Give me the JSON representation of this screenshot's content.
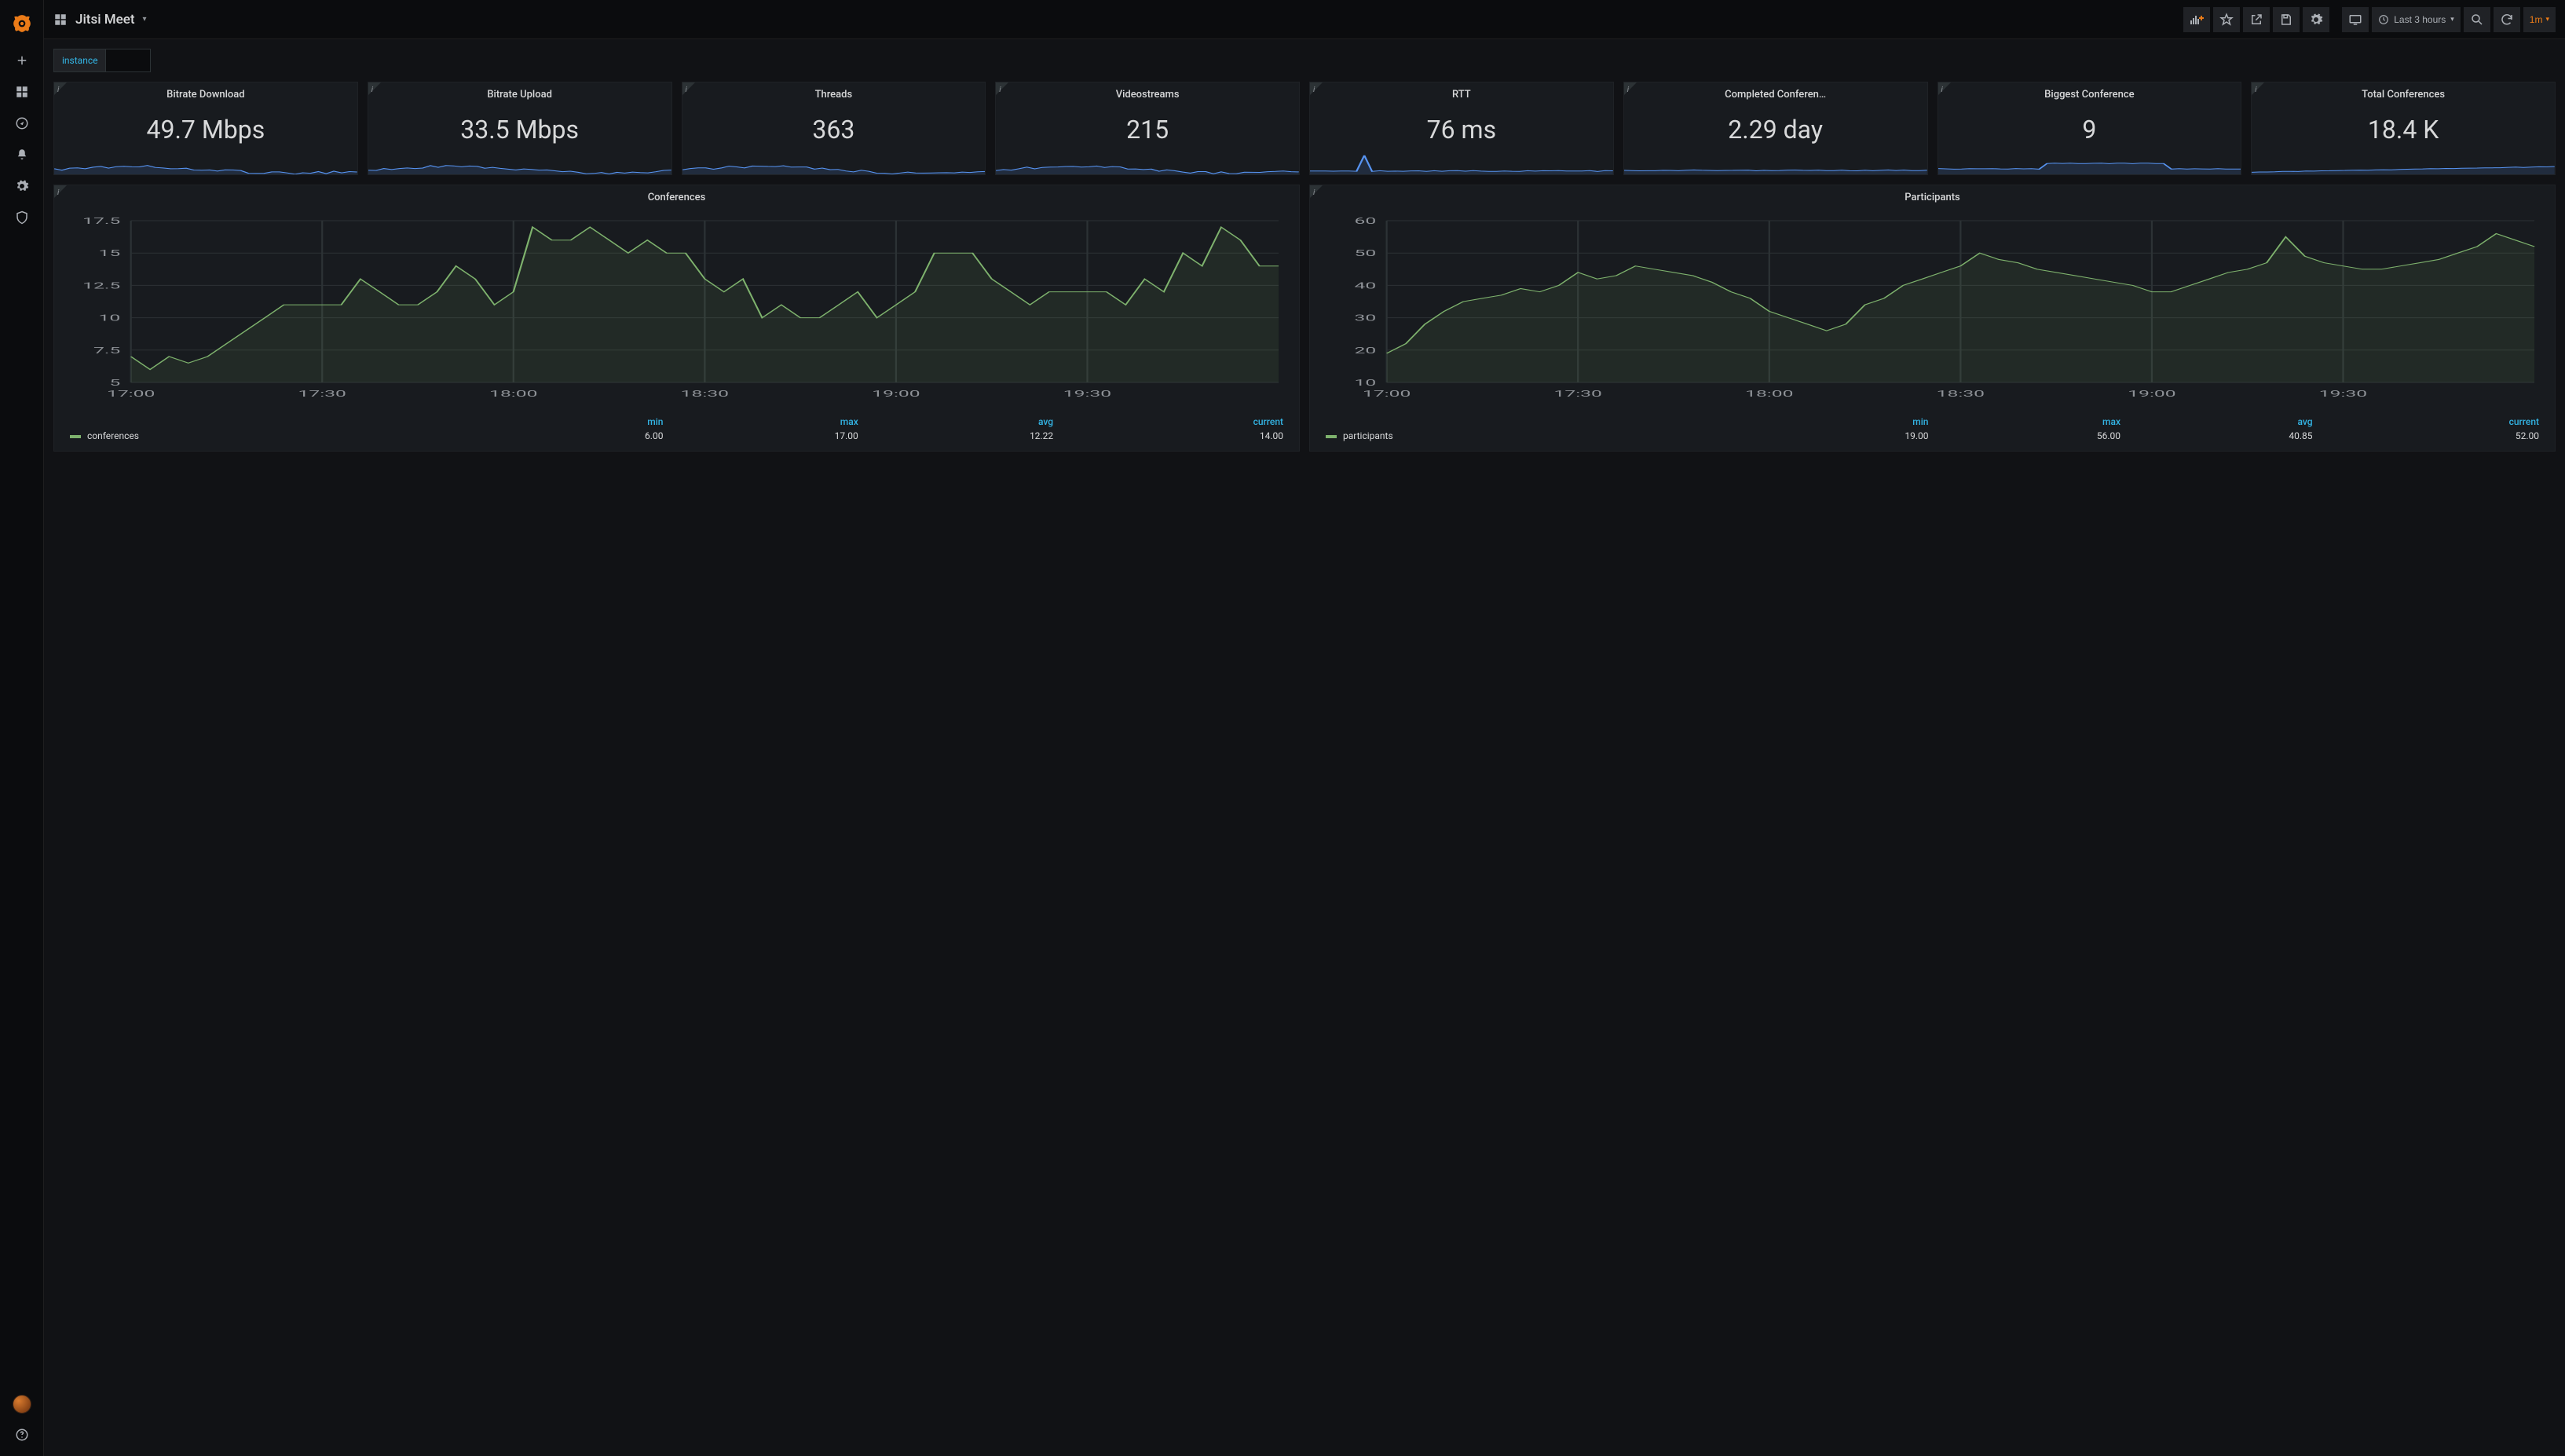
{
  "dashboard_title": "Jitsi Meet",
  "time_range": "Last 3 hours",
  "refresh_interval": "1m",
  "variable": {
    "label": "instance",
    "value": ""
  },
  "stat_panels": [
    {
      "title": "Bitrate Download",
      "value": "49.7 Mbps"
    },
    {
      "title": "Bitrate Upload",
      "value": "33.5 Mbps"
    },
    {
      "title": "Threads",
      "value": "363"
    },
    {
      "title": "Videostreams",
      "value": "215"
    },
    {
      "title": "RTT",
      "value": "76 ms"
    },
    {
      "title": "Completed Conferen…",
      "value": "2.29 day"
    },
    {
      "title": "Biggest Conference",
      "value": "9"
    },
    {
      "title": "Total Conferences",
      "value": "18.4 K"
    }
  ],
  "chart_panels": [
    {
      "title": "Conferences",
      "series_name": "conferences",
      "legend_headers": [
        "min",
        "max",
        "avg",
        "current"
      ],
      "legend_values": [
        "6.00",
        "17.00",
        "12.22",
        "14.00"
      ]
    },
    {
      "title": "Participants",
      "series_name": "participants",
      "legend_headers": [
        "min",
        "max",
        "avg",
        "current"
      ],
      "legend_values": [
        "19.00",
        "56.00",
        "40.85",
        "52.00"
      ]
    }
  ],
  "chart_data": [
    {
      "type": "line",
      "title": "Conferences",
      "xlabel": "",
      "ylabel": "",
      "ylim": [
        5,
        17.5
      ],
      "x_ticks": [
        "17:00",
        "17:30",
        "18:00",
        "18:30",
        "19:00",
        "19:30"
      ],
      "y_ticks": [
        5.0,
        7.5,
        10.0,
        12.5,
        15.0,
        17.5
      ],
      "series": [
        {
          "name": "conferences",
          "x_minutes": [
            0,
            3,
            6,
            9,
            12,
            15,
            18,
            21,
            24,
            27,
            30,
            33,
            36,
            39,
            42,
            45,
            48,
            51,
            54,
            57,
            60,
            63,
            66,
            69,
            72,
            75,
            78,
            81,
            84,
            87,
            90,
            93,
            96,
            99,
            102,
            105,
            108,
            111,
            114,
            117,
            120,
            123,
            126,
            129,
            132,
            135,
            138,
            141,
            144,
            147,
            150,
            153,
            156,
            159,
            162,
            165,
            168,
            171,
            174,
            177,
            180
          ],
          "y": [
            7,
            6,
            7,
            6.5,
            7,
            8,
            9,
            10,
            11,
            11,
            11,
            11,
            13,
            12,
            11,
            11,
            12,
            14,
            13,
            11,
            12,
            17,
            16,
            16,
            17,
            16,
            15,
            16,
            15,
            15,
            13,
            12,
            13,
            10,
            11,
            10,
            10,
            11,
            12,
            10,
            11,
            12,
            15,
            15,
            15,
            13,
            12,
            11,
            12,
            12,
            12,
            12,
            11,
            13,
            12,
            15,
            14,
            17,
            16,
            14,
            14
          ]
        }
      ]
    },
    {
      "type": "line",
      "title": "Participants",
      "xlabel": "",
      "ylabel": "",
      "ylim": [
        10,
        60
      ],
      "x_ticks": [
        "17:00",
        "17:30",
        "18:00",
        "18:30",
        "19:00",
        "19:30"
      ],
      "y_ticks": [
        10,
        20,
        30,
        40,
        50,
        60
      ],
      "series": [
        {
          "name": "participants",
          "x_minutes": [
            0,
            3,
            6,
            9,
            12,
            15,
            18,
            21,
            24,
            27,
            30,
            33,
            36,
            39,
            42,
            45,
            48,
            51,
            54,
            57,
            60,
            63,
            66,
            69,
            72,
            75,
            78,
            81,
            84,
            87,
            90,
            93,
            96,
            99,
            102,
            105,
            108,
            111,
            114,
            117,
            120,
            123,
            126,
            129,
            132,
            135,
            138,
            141,
            144,
            147,
            150,
            153,
            156,
            159,
            162,
            165,
            168,
            171,
            174,
            177,
            180
          ],
          "y": [
            19,
            22,
            28,
            32,
            35,
            36,
            37,
            39,
            38,
            40,
            44,
            42,
            43,
            46,
            45,
            44,
            43,
            41,
            38,
            36,
            32,
            30,
            28,
            26,
            28,
            34,
            36,
            40,
            42,
            44,
            46,
            50,
            48,
            47,
            45,
            44,
            43,
            42,
            41,
            40,
            38,
            38,
            40,
            42,
            44,
            45,
            47,
            55,
            49,
            47,
            46,
            45,
            45,
            46,
            47,
            48,
            50,
            52,
            56,
            54,
            52
          ]
        }
      ]
    }
  ],
  "sidebar_icons": [
    "plus-icon",
    "dashboard-grid-icon",
    "compass-icon",
    "bell-icon",
    "gear-icon",
    "shield-icon"
  ],
  "colors": {
    "accent": "#eb7b18",
    "blue": "#5794f2",
    "teal": "#33b5e5",
    "green": "#7eb26d"
  }
}
